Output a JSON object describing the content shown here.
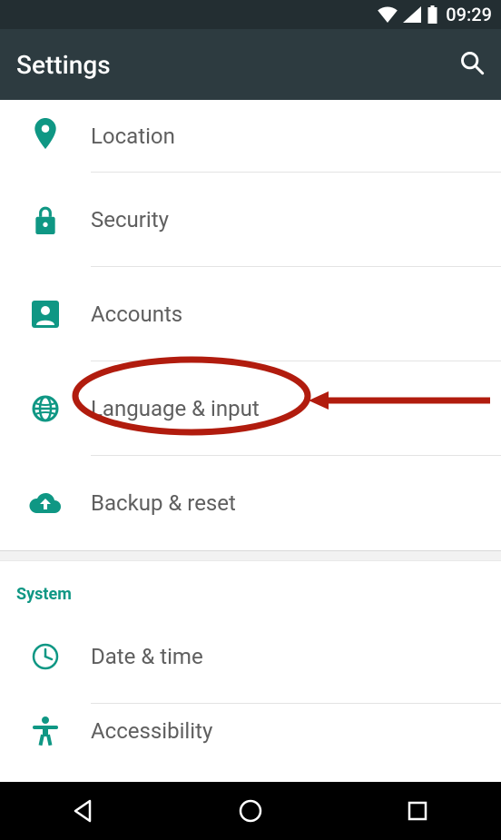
{
  "status": {
    "time": "09:29"
  },
  "appbar": {
    "title": "Settings"
  },
  "items": [
    {
      "label": "Location",
      "icon": "location-pin-icon"
    },
    {
      "label": "Security",
      "icon": "lock-icon"
    },
    {
      "label": "Accounts",
      "icon": "person-box-icon"
    },
    {
      "label": "Language & input",
      "icon": "globe-icon"
    },
    {
      "label": "Backup & reset",
      "icon": "cloud-upload-icon"
    }
  ],
  "section": {
    "system_label": "System"
  },
  "system_items": [
    {
      "label": "Date & time",
      "icon": "clock-icon"
    },
    {
      "label": "Accessibility",
      "icon": "accessibility-icon"
    }
  ],
  "annotation": {
    "target_label": "Language & input",
    "color": "#b11c0e"
  }
}
